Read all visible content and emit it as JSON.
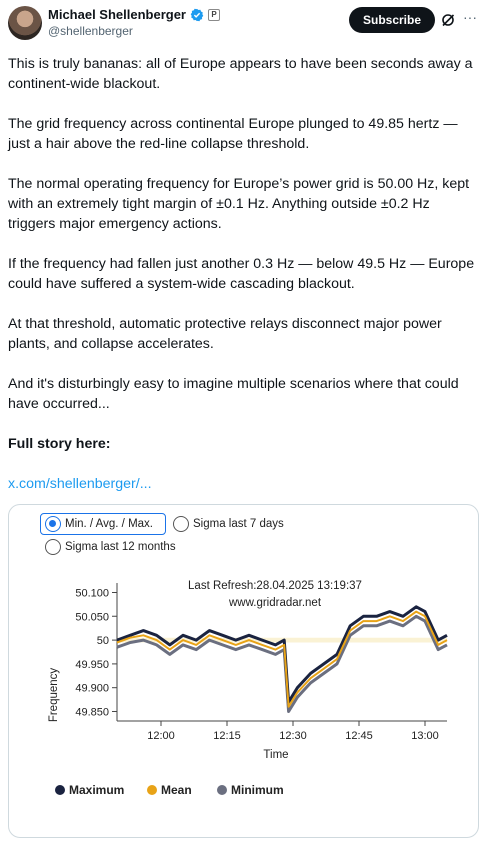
{
  "author": {
    "name": "Michael Shellenberger",
    "handle": "@shellenberger",
    "badge_letter": "P",
    "verified_color": "#1d9bf0"
  },
  "actions": {
    "subscribe_label": "Subscribe",
    "grok_icon": "grok-icon",
    "more_icon": "more-icon"
  },
  "tweet": {
    "paragraphs": [
      "This is truly bananas: all of Europe appears to have been seconds away a continent-wide blackout.",
      "The grid frequency across continental Europe plunged to 49.85 hertz — just a hair above the red-line collapse threshold.",
      "The normal operating frequency for Europe’s power grid is 50.00 Hz, kept with an extremely tight margin of ±0.1 Hz. Anything outside ±0.2 Hz triggers major emergency actions.",
      "If the frequency had fallen just another 0.3 Hz — below 49.5 Hz — Europe could have suffered a system-wide cascading blackout.",
      "At that threshold, automatic protective relays disconnect major power plants, and collapse accelerates.",
      "And it's disturbingly easy to imagine multiple scenarios where that could have occurred..."
    ],
    "full_story": "Full story here:",
    "link": "x.com/shellenberger/..."
  },
  "chart_panel": {
    "radio_minavgmax": "Min. / Avg. / Max.",
    "radio_sigma7": "Sigma last 7 days",
    "radio_sigma12": "Sigma last 12 months",
    "last_refresh": "Last Refresh:28.04.2025 13:19:37",
    "source": "www.gridradar.net"
  },
  "chart_data": {
    "type": "line",
    "ylabel": "Frequency",
    "xlabel": "Time",
    "y_ticks": [
      "50.100",
      "50.050",
      "50",
      "49.950",
      "49.900",
      "49.850"
    ],
    "y_tick_values": [
      50.1,
      50.05,
      50.0,
      49.95,
      49.9,
      49.85
    ],
    "x_ticks": [
      "12:00",
      "12:15",
      "12:30",
      "12:45",
      "13:00"
    ],
    "ylim": [
      49.83,
      50.12
    ],
    "xlim": [
      "11:50",
      "13:05"
    ],
    "grid": false,
    "legend_position": "bottom",
    "series": [
      {
        "name": "Maximum",
        "color": "#1a2340",
        "x": [
          "11:50",
          "11:53",
          "11:56",
          "11:59",
          "12:02",
          "12:05",
          "12:08",
          "12:11",
          "12:14",
          "12:17",
          "12:20",
          "12:23",
          "12:26",
          "12:28",
          "12:29",
          "12:31",
          "12:34",
          "12:37",
          "12:40",
          "12:43",
          "12:46",
          "12:49",
          "12:52",
          "12:55",
          "12:58",
          "13:00",
          "13:02",
          "13:03",
          "13:05"
        ],
        "values": [
          50.0,
          50.01,
          50.02,
          50.01,
          49.99,
          50.01,
          50.0,
          50.02,
          50.01,
          50.0,
          50.01,
          50.0,
          49.99,
          50.0,
          49.87,
          49.9,
          49.93,
          49.95,
          49.97,
          50.03,
          50.05,
          50.05,
          50.06,
          50.05,
          50.07,
          50.06,
          50.02,
          50.0,
          50.01
        ]
      },
      {
        "name": "Mean",
        "color": "#e8a317",
        "x": [
          "11:50",
          "11:53",
          "11:56",
          "11:59",
          "12:02",
          "12:05",
          "12:08",
          "12:11",
          "12:14",
          "12:17",
          "12:20",
          "12:23",
          "12:26",
          "12:28",
          "12:29",
          "12:31",
          "12:34",
          "12:37",
          "12:40",
          "12:43",
          "12:46",
          "12:49",
          "12:52",
          "12:55",
          "12:58",
          "13:00",
          "13:02",
          "13:03",
          "13:05"
        ],
        "values": [
          49.995,
          50.005,
          50.01,
          50.0,
          49.98,
          50.0,
          49.99,
          50.01,
          50.0,
          49.99,
          50.0,
          49.99,
          49.98,
          49.99,
          49.86,
          49.89,
          49.92,
          49.94,
          49.96,
          50.02,
          50.04,
          50.04,
          50.05,
          50.04,
          50.06,
          50.05,
          50.01,
          49.99,
          50.0
        ]
      },
      {
        "name": "Minimum",
        "color": "#6b6f80",
        "x": [
          "11:50",
          "11:53",
          "11:56",
          "11:59",
          "12:02",
          "12:05",
          "12:08",
          "12:11",
          "12:14",
          "12:17",
          "12:20",
          "12:23",
          "12:26",
          "12:28",
          "12:29",
          "12:31",
          "12:34",
          "12:37",
          "12:40",
          "12:43",
          "12:46",
          "12:49",
          "12:52",
          "12:55",
          "12:58",
          "13:00",
          "13:02",
          "13:03",
          "13:05"
        ],
        "values": [
          49.985,
          49.995,
          50.0,
          49.99,
          49.97,
          49.99,
          49.98,
          50.0,
          49.99,
          49.98,
          49.99,
          49.98,
          49.97,
          49.98,
          49.85,
          49.88,
          49.91,
          49.93,
          49.95,
          50.01,
          50.03,
          50.03,
          50.04,
          50.03,
          50.05,
          50.04,
          50.0,
          49.98,
          49.99
        ]
      }
    ],
    "reference_band_color": "#f3e3a0"
  }
}
